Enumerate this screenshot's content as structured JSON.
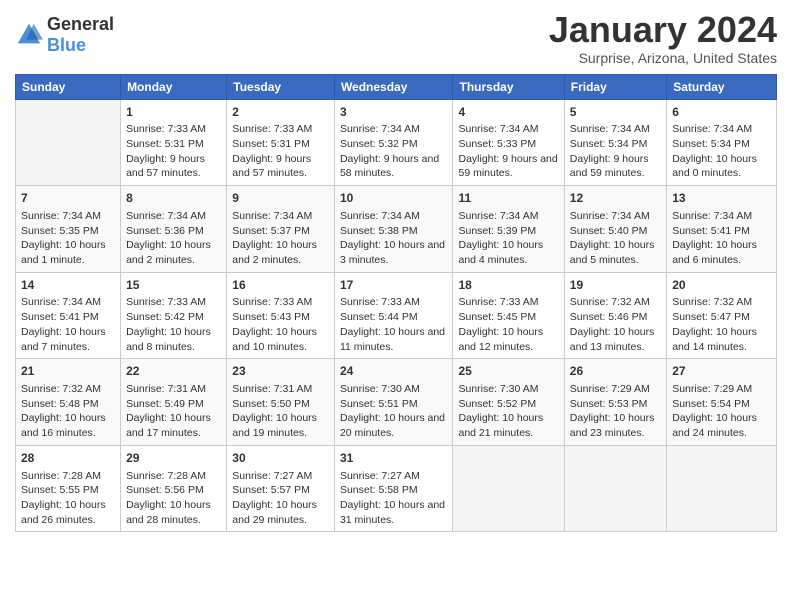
{
  "header": {
    "logo_general": "General",
    "logo_blue": "Blue",
    "month_title": "January 2024",
    "location": "Surprise, Arizona, United States"
  },
  "days_of_week": [
    "Sunday",
    "Monday",
    "Tuesday",
    "Wednesday",
    "Thursday",
    "Friday",
    "Saturday"
  ],
  "weeks": [
    [
      {
        "day": "",
        "sunrise": "",
        "sunset": "",
        "daylight": ""
      },
      {
        "day": "1",
        "sunrise": "Sunrise: 7:33 AM",
        "sunset": "Sunset: 5:31 PM",
        "daylight": "Daylight: 9 hours and 57 minutes."
      },
      {
        "day": "2",
        "sunrise": "Sunrise: 7:33 AM",
        "sunset": "Sunset: 5:31 PM",
        "daylight": "Daylight: 9 hours and 57 minutes."
      },
      {
        "day": "3",
        "sunrise": "Sunrise: 7:34 AM",
        "sunset": "Sunset: 5:32 PM",
        "daylight": "Daylight: 9 hours and 58 minutes."
      },
      {
        "day": "4",
        "sunrise": "Sunrise: 7:34 AM",
        "sunset": "Sunset: 5:33 PM",
        "daylight": "Daylight: 9 hours and 59 minutes."
      },
      {
        "day": "5",
        "sunrise": "Sunrise: 7:34 AM",
        "sunset": "Sunset: 5:34 PM",
        "daylight": "Daylight: 9 hours and 59 minutes."
      },
      {
        "day": "6",
        "sunrise": "Sunrise: 7:34 AM",
        "sunset": "Sunset: 5:34 PM",
        "daylight": "Daylight: 10 hours and 0 minutes."
      }
    ],
    [
      {
        "day": "7",
        "sunrise": "Sunrise: 7:34 AM",
        "sunset": "Sunset: 5:35 PM",
        "daylight": "Daylight: 10 hours and 1 minute."
      },
      {
        "day": "8",
        "sunrise": "Sunrise: 7:34 AM",
        "sunset": "Sunset: 5:36 PM",
        "daylight": "Daylight: 10 hours and 2 minutes."
      },
      {
        "day": "9",
        "sunrise": "Sunrise: 7:34 AM",
        "sunset": "Sunset: 5:37 PM",
        "daylight": "Daylight: 10 hours and 2 minutes."
      },
      {
        "day": "10",
        "sunrise": "Sunrise: 7:34 AM",
        "sunset": "Sunset: 5:38 PM",
        "daylight": "Daylight: 10 hours and 3 minutes."
      },
      {
        "day": "11",
        "sunrise": "Sunrise: 7:34 AM",
        "sunset": "Sunset: 5:39 PM",
        "daylight": "Daylight: 10 hours and 4 minutes."
      },
      {
        "day": "12",
        "sunrise": "Sunrise: 7:34 AM",
        "sunset": "Sunset: 5:40 PM",
        "daylight": "Daylight: 10 hours and 5 minutes."
      },
      {
        "day": "13",
        "sunrise": "Sunrise: 7:34 AM",
        "sunset": "Sunset: 5:41 PM",
        "daylight": "Daylight: 10 hours and 6 minutes."
      }
    ],
    [
      {
        "day": "14",
        "sunrise": "Sunrise: 7:34 AM",
        "sunset": "Sunset: 5:41 PM",
        "daylight": "Daylight: 10 hours and 7 minutes."
      },
      {
        "day": "15",
        "sunrise": "Sunrise: 7:33 AM",
        "sunset": "Sunset: 5:42 PM",
        "daylight": "Daylight: 10 hours and 8 minutes."
      },
      {
        "day": "16",
        "sunrise": "Sunrise: 7:33 AM",
        "sunset": "Sunset: 5:43 PM",
        "daylight": "Daylight: 10 hours and 10 minutes."
      },
      {
        "day": "17",
        "sunrise": "Sunrise: 7:33 AM",
        "sunset": "Sunset: 5:44 PM",
        "daylight": "Daylight: 10 hours and 11 minutes."
      },
      {
        "day": "18",
        "sunrise": "Sunrise: 7:33 AM",
        "sunset": "Sunset: 5:45 PM",
        "daylight": "Daylight: 10 hours and 12 minutes."
      },
      {
        "day": "19",
        "sunrise": "Sunrise: 7:32 AM",
        "sunset": "Sunset: 5:46 PM",
        "daylight": "Daylight: 10 hours and 13 minutes."
      },
      {
        "day": "20",
        "sunrise": "Sunrise: 7:32 AM",
        "sunset": "Sunset: 5:47 PM",
        "daylight": "Daylight: 10 hours and 14 minutes."
      }
    ],
    [
      {
        "day": "21",
        "sunrise": "Sunrise: 7:32 AM",
        "sunset": "Sunset: 5:48 PM",
        "daylight": "Daylight: 10 hours and 16 minutes."
      },
      {
        "day": "22",
        "sunrise": "Sunrise: 7:31 AM",
        "sunset": "Sunset: 5:49 PM",
        "daylight": "Daylight: 10 hours and 17 minutes."
      },
      {
        "day": "23",
        "sunrise": "Sunrise: 7:31 AM",
        "sunset": "Sunset: 5:50 PM",
        "daylight": "Daylight: 10 hours and 19 minutes."
      },
      {
        "day": "24",
        "sunrise": "Sunrise: 7:30 AM",
        "sunset": "Sunset: 5:51 PM",
        "daylight": "Daylight: 10 hours and 20 minutes."
      },
      {
        "day": "25",
        "sunrise": "Sunrise: 7:30 AM",
        "sunset": "Sunset: 5:52 PM",
        "daylight": "Daylight: 10 hours and 21 minutes."
      },
      {
        "day": "26",
        "sunrise": "Sunrise: 7:29 AM",
        "sunset": "Sunset: 5:53 PM",
        "daylight": "Daylight: 10 hours and 23 minutes."
      },
      {
        "day": "27",
        "sunrise": "Sunrise: 7:29 AM",
        "sunset": "Sunset: 5:54 PM",
        "daylight": "Daylight: 10 hours and 24 minutes."
      }
    ],
    [
      {
        "day": "28",
        "sunrise": "Sunrise: 7:28 AM",
        "sunset": "Sunset: 5:55 PM",
        "daylight": "Daylight: 10 hours and 26 minutes."
      },
      {
        "day": "29",
        "sunrise": "Sunrise: 7:28 AM",
        "sunset": "Sunset: 5:56 PM",
        "daylight": "Daylight: 10 hours and 28 minutes."
      },
      {
        "day": "30",
        "sunrise": "Sunrise: 7:27 AM",
        "sunset": "Sunset: 5:57 PM",
        "daylight": "Daylight: 10 hours and 29 minutes."
      },
      {
        "day": "31",
        "sunrise": "Sunrise: 7:27 AM",
        "sunset": "Sunset: 5:58 PM",
        "daylight": "Daylight: 10 hours and 31 minutes."
      },
      {
        "day": "",
        "sunrise": "",
        "sunset": "",
        "daylight": ""
      },
      {
        "day": "",
        "sunrise": "",
        "sunset": "",
        "daylight": ""
      },
      {
        "day": "",
        "sunrise": "",
        "sunset": "",
        "daylight": ""
      }
    ]
  ]
}
